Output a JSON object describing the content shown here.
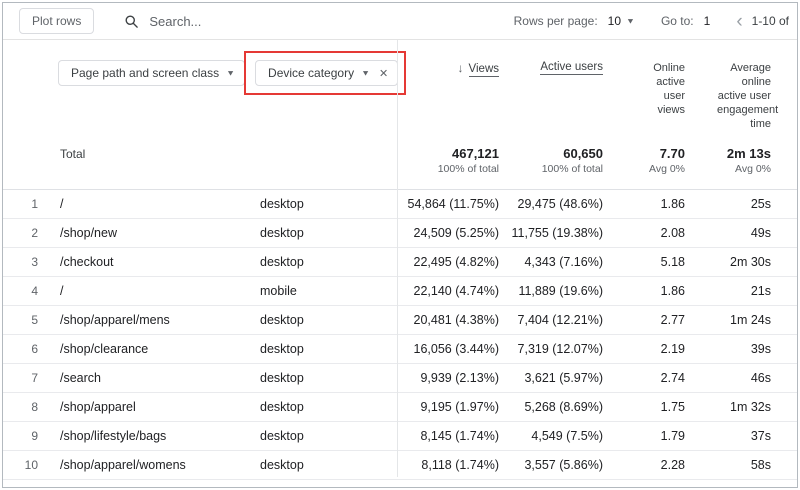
{
  "toolbar": {
    "plot_rows_label": "Plot rows",
    "search_placeholder": "Search...",
    "rows_per_page_label": "Rows per page:",
    "rows_per_page_value": "10",
    "go_to_label": "Go to:",
    "go_to_value": "1",
    "page_range": "1-10 of"
  },
  "dimensions": {
    "primary_label": "Page path and screen class",
    "secondary_label": "Device category"
  },
  "annotation": {
    "highlight_color": "#e53935"
  },
  "table": {
    "columns": {
      "views": "Views",
      "active_users": "Active users",
      "online_active_user_views": "Online active user views",
      "avg_engagement_time": "Average online active user engagement time"
    },
    "sort": {
      "column": "Views",
      "direction": "desc"
    },
    "totals": {
      "label": "Total",
      "views": "467,121",
      "views_pct": "100% of total",
      "active_users": "60,650",
      "active_users_pct": "100% of total",
      "online_views": "7.70",
      "online_views_avg": "Avg 0%",
      "engagement": "2m 13s",
      "engagement_avg": "Avg 0%"
    },
    "rows": [
      {
        "num": "1",
        "path": "/",
        "device": "desktop",
        "views": "54,864 (11.75%)",
        "active_users": "29,475 (48.6%)",
        "online_views": "1.86",
        "engagement": "25s"
      },
      {
        "num": "2",
        "path": "/shop/new",
        "device": "desktop",
        "views": "24,509 (5.25%)",
        "active_users": "11,755 (19.38%)",
        "online_views": "2.08",
        "engagement": "49s"
      },
      {
        "num": "3",
        "path": "/checkout",
        "device": "desktop",
        "views": "22,495 (4.82%)",
        "active_users": "4,343 (7.16%)",
        "online_views": "5.18",
        "engagement": "2m 30s"
      },
      {
        "num": "4",
        "path": "/",
        "device": "mobile",
        "views": "22,140 (4.74%)",
        "active_users": "11,889 (19.6%)",
        "online_views": "1.86",
        "engagement": "21s"
      },
      {
        "num": "5",
        "path": "/shop/apparel/mens",
        "device": "desktop",
        "views": "20,481 (4.38%)",
        "active_users": "7,404 (12.21%)",
        "online_views": "2.77",
        "engagement": "1m 24s"
      },
      {
        "num": "6",
        "path": "/shop/clearance",
        "device": "desktop",
        "views": "16,056 (3.44%)",
        "active_users": "7,319 (12.07%)",
        "online_views": "2.19",
        "engagement": "39s"
      },
      {
        "num": "7",
        "path": "/search",
        "device": "desktop",
        "views": "9,939 (2.13%)",
        "active_users": "3,621 (5.97%)",
        "online_views": "2.74",
        "engagement": "46s"
      },
      {
        "num": "8",
        "path": "/shop/apparel",
        "device": "desktop",
        "views": "9,195 (1.97%)",
        "active_users": "5,268 (8.69%)",
        "online_views": "1.75",
        "engagement": "1m 32s"
      },
      {
        "num": "9",
        "path": "/shop/lifestyle/bags",
        "device": "desktop",
        "views": "8,145 (1.74%)",
        "active_users": "4,549 (7.5%)",
        "online_views": "1.79",
        "engagement": "37s"
      },
      {
        "num": "10",
        "path": "/shop/apparel/womens",
        "device": "desktop",
        "views": "8,118 (1.74%)",
        "active_users": "3,557 (5.86%)",
        "online_views": "2.28",
        "engagement": "58s"
      }
    ]
  }
}
